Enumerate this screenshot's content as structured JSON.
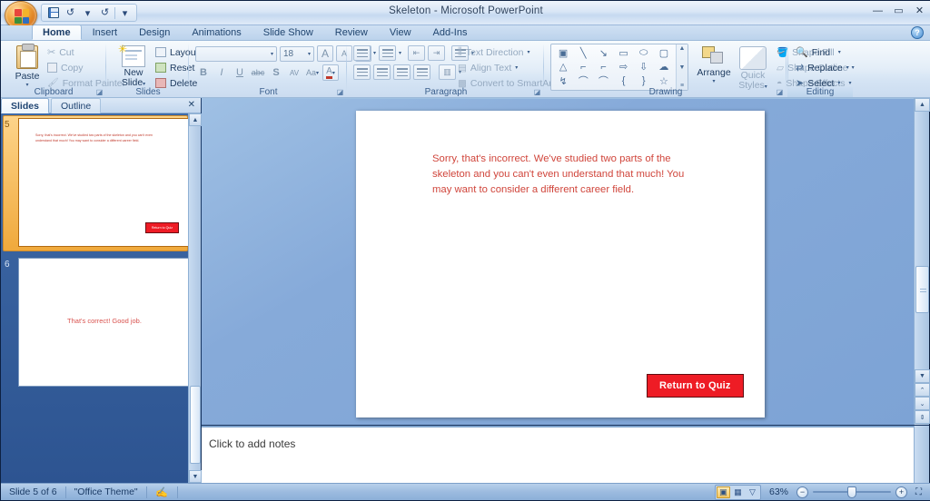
{
  "window": {
    "title": "Skeleton - Microsoft PowerPoint",
    "minimize": "—",
    "maximize": "▭",
    "close": "✕",
    "help": "?"
  },
  "quick_access": {
    "save": "save-icon",
    "undo": "↺",
    "undo_arrow": "▾",
    "redo": "↻",
    "customize": "▾"
  },
  "tabs": [
    {
      "label": "Home",
      "active": true
    },
    {
      "label": "Insert",
      "active": false
    },
    {
      "label": "Design",
      "active": false
    },
    {
      "label": "Animations",
      "active": false
    },
    {
      "label": "Slide Show",
      "active": false
    },
    {
      "label": "Review",
      "active": false
    },
    {
      "label": "View",
      "active": false
    },
    {
      "label": "Add-Ins",
      "active": false
    }
  ],
  "ribbon": {
    "clipboard": {
      "group_label": "Clipboard",
      "paste": "Paste",
      "paste_arrow": "▾",
      "cut": "Cut",
      "copy": "Copy",
      "format_painter": "Format Painter",
      "dialog_launcher": "◪"
    },
    "slides": {
      "group_label": "Slides",
      "new_slide": "New\nSlide",
      "new_slide_line1": "New",
      "new_slide_line2": "Slide",
      "new_slide_arrow": "▾",
      "layout": "Layout",
      "layout_arrow": "▾",
      "reset": "Reset",
      "delete": "Delete"
    },
    "font": {
      "group_label": "Font",
      "font_name": "",
      "font_name_arrow": "▾",
      "font_size": "18",
      "font_size_arrow": "▾",
      "grow_font": "A",
      "shrink_font": "A",
      "clear_formatting": "⌫",
      "bold": "B",
      "italic": "I",
      "underline": "U",
      "strikethrough": "abc",
      "shadow": "S",
      "character_spacing": "AV",
      "change_case": "Aa",
      "font_color": "A",
      "dialog_launcher": "◪"
    },
    "paragraph": {
      "group_label": "Paragraph",
      "bullets": "•≡",
      "numbering": "1≡",
      "decrease_indent": "⇤",
      "increase_indent": "⇥",
      "line_spacing": "↕≡",
      "align_left": "≡",
      "align_center": "≡",
      "align_right": "≡",
      "justify": "≡",
      "columns": "▥",
      "text_direction": "Text Direction",
      "align_text": "Align Text",
      "convert_to_smartart": "Convert to SmartArt",
      "dialog_launcher": "◪"
    },
    "drawing": {
      "group_label": "Drawing",
      "shapes": [
        "▣",
        "╲",
        "↘",
        "▭",
        "⬭",
        "▢",
        "△",
        "⌐",
        "⌐",
        "⇨",
        "⇩",
        "☁",
        "↯",
        "⌒",
        "⌒",
        "{",
        "}",
        "☆"
      ],
      "gallery_up": "▲",
      "gallery_down": "▼",
      "gallery_more": "≡",
      "arrange": "Arrange",
      "arrange_arrow": "▾",
      "quick_styles_line1": "Quick",
      "quick_styles_line2": "Styles",
      "quick_styles_arrow": "▾",
      "shape_fill": "Shape Fill",
      "shape_outline": "Shape Outline",
      "shape_effects": "Shape Effects",
      "dialog_launcher": "◪"
    },
    "editing": {
      "group_label": "Editing",
      "find": "Find",
      "replace": "Replace",
      "select": "Select",
      "dropdown_arrow": "▾"
    }
  },
  "left_pane": {
    "tab_slides": "Slides",
    "tab_outline": "Outline",
    "close": "✕",
    "scroll_up": "▲",
    "scroll_down": "▼",
    "slides": [
      {
        "number": "5",
        "selected": true,
        "text": "Sorry, that's incorrect.  We've studied two parts of the skeleton and you can't even understand that much!  You may want to consider a different career field.",
        "button": "Return to Quiz"
      },
      {
        "number": "6",
        "selected": false,
        "center_text": "That's correct! Good job."
      }
    ]
  },
  "slide": {
    "body_text": "Sorry, that's incorrect.  We've studied two parts of the skeleton and you can't even understand that much!  You may want to consider a different career field.",
    "button_label": "Return to Quiz",
    "button_color": "#ee1c25",
    "text_color": "#d0453b"
  },
  "scrollbars": {
    "up": "▲",
    "down": "▼",
    "prev_slide": "⌃",
    "next_slide": "⌄",
    "back_to_start": "⇕"
  },
  "notes": {
    "placeholder": "Click to add notes"
  },
  "status_bar": {
    "slide_position": "Slide 5 of 6",
    "theme": "\"Office Theme\"",
    "spell_check": "spell-check-icon",
    "view_normal": "▣",
    "view_sorter": "▦",
    "view_slideshow": "▽",
    "zoom_level": "63%",
    "zoom_out": "−",
    "zoom_in": "+",
    "fit_to_window": "⛶"
  }
}
